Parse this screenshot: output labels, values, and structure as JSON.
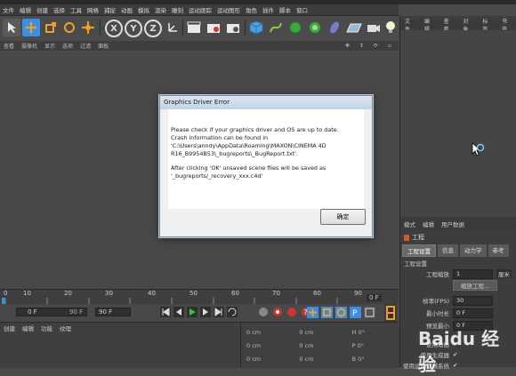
{
  "menubar": {
    "items": [
      "文件",
      "编辑",
      "创建",
      "选择",
      "工具",
      "网格",
      "捕捉",
      "动画",
      "模拟",
      "渲染",
      "雕刻",
      "运动跟踪",
      "运动图形",
      "角色",
      "插件",
      "脚本",
      "窗口",
      "帮助"
    ]
  },
  "viewport_menu": {
    "items": [
      "查看",
      "摄像机",
      "显示",
      "选项",
      "过滤",
      "面板"
    ]
  },
  "right_panel": {
    "tabs": [
      "文件",
      "编辑",
      "查看",
      "对象",
      "标签",
      "书签"
    ]
  },
  "attributes": {
    "tabs": [
      "模式",
      "编辑",
      "用户数据"
    ],
    "title": "工程",
    "sub_tabs": [
      "工程设置",
      "信息",
      "动力学",
      "参考"
    ],
    "section": "工程设置",
    "rows": [
      {
        "label": "工程缩放",
        "value": "1",
        "unit": "厘米"
      },
      {
        "label": "",
        "value": "缩放工程..."
      },
      {
        "label": "帧率(FPS)",
        "value": "30"
      },
      {
        "label": "最小时长",
        "value": "0 F"
      },
      {
        "label": "预览最小",
        "value": "0 F"
      },
      {
        "label": "使用动画",
        "value": "✔"
      },
      {
        "label": "使用生成器",
        "value": "✔"
      },
      {
        "label": "使用运动剪辑系统",
        "value": "✔"
      }
    ]
  },
  "timeline": {
    "ticks": [
      "0",
      "10",
      "20",
      "30",
      "40",
      "50",
      "60",
      "70",
      "80",
      "90"
    ],
    "end_frame": "0 F"
  },
  "transport": {
    "start": "0 F",
    "end": "90 F",
    "max": "90 F"
  },
  "lower_menu": {
    "items": [
      "创建",
      "编辑",
      "功能",
      "纹理"
    ]
  },
  "coords": {
    "rows": [
      "0 cm",
      "0 cm",
      "0 cm"
    ],
    "mid": [
      "0 cm",
      "0 cm",
      "0 cm"
    ],
    "angles": [
      "H 0°",
      "P 0°",
      "B 0°"
    ]
  },
  "dialog": {
    "title": "Graphics Driver Error",
    "para1": "Please check if your graphics driver and OS are up to date.\nCrash information can be found in\n'C:\\Users\\anndy\\AppData\\Roaming\\MAXON\\CINEMA 4D\nR16_B9954B53\\_bugreports\\_BugReport.txt'.",
    "para2": "After clicking 'OK' unsaved scene files will be saved as\n'_bugreports/_recovery_xxx.c4d'",
    "ok_label": "确定"
  },
  "watermark": "Baidu 经验",
  "colors": {
    "bg": "#4a4a4a",
    "accent_blue": "#3a8ee6",
    "dialog_bg": "#f0f0f0"
  }
}
